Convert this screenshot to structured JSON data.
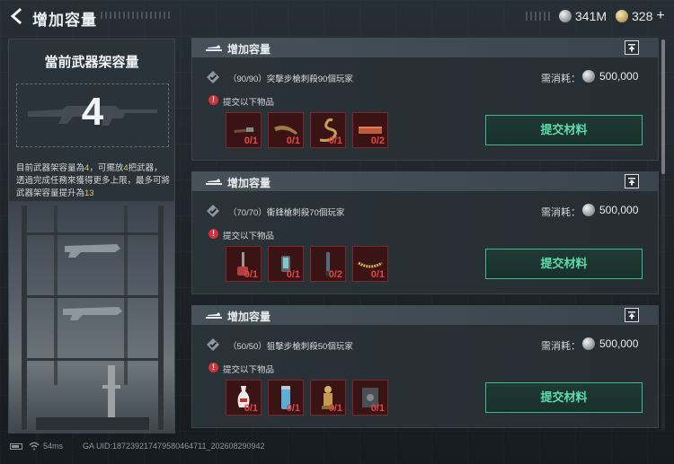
{
  "header": {
    "title": "增加容量",
    "currencies": [
      {
        "icon": "silver-coin-icon",
        "value": "341M"
      },
      {
        "icon": "gold-coin-icon",
        "value": "328"
      }
    ]
  },
  "left_panel": {
    "title": "當前武器架容量",
    "capacity": "4",
    "desc_parts": [
      "目前武器架容量為",
      "4",
      "，可擺放",
      "4",
      "把武器，透過完成任務來獲得更多上限，最多可將武器架容量提升為",
      "13"
    ]
  },
  "cards": [
    {
      "title": "增加容量",
      "task": "（90/90）突擊步槍刺殺90個玩家",
      "cost_label": "需消耗：",
      "cost_value": "500,000",
      "requirement": "提交以下物品",
      "items": [
        {
          "icon": "tool-kit-icon",
          "qty": "0/1"
        },
        {
          "icon": "horn-icon",
          "qty": "0/1"
        },
        {
          "icon": "snake-figure-icon",
          "qty": "0/1"
        },
        {
          "icon": "cigar-box-icon",
          "qty": "0/2"
        }
      ],
      "button": "提交材料"
    },
    {
      "title": "增加容量",
      "task": "（70/70）衝鋒槍刺殺70個玩家",
      "cost_label": "需消耗：",
      "cost_value": "500,000",
      "requirement": "提交以下物品",
      "items": [
        {
          "icon": "vacuum-cleaner-icon",
          "qty": "0/1"
        },
        {
          "icon": "lantern-icon",
          "qty": "0/1"
        },
        {
          "icon": "hand-truck-icon",
          "qty": "0/2"
        },
        {
          "icon": "necklace-icon",
          "qty": "0/1"
        }
      ],
      "button": "提交材料"
    },
    {
      "title": "增加容量",
      "task": "（50/50）狙擊步槍刺殺50個玩家",
      "cost_label": "需消耗：",
      "cost_value": "500,000",
      "requirement": "提交以下物品",
      "items": [
        {
          "icon": "vase-icon",
          "qty": "0/1"
        },
        {
          "icon": "thermos-icon",
          "qty": "0/1"
        },
        {
          "icon": "statue-icon",
          "qty": "0/1"
        },
        {
          "icon": "safe-box-icon",
          "qty": "0/1"
        }
      ],
      "button": "提交材料"
    }
  ],
  "status": {
    "ping": "54ms",
    "uid": "GA UID:187239217479580464711_202608290942"
  },
  "colors": {
    "accent_green": "#5fdcae",
    "missing_red": "#e04646",
    "highlight_gold": "#e7c36a"
  }
}
